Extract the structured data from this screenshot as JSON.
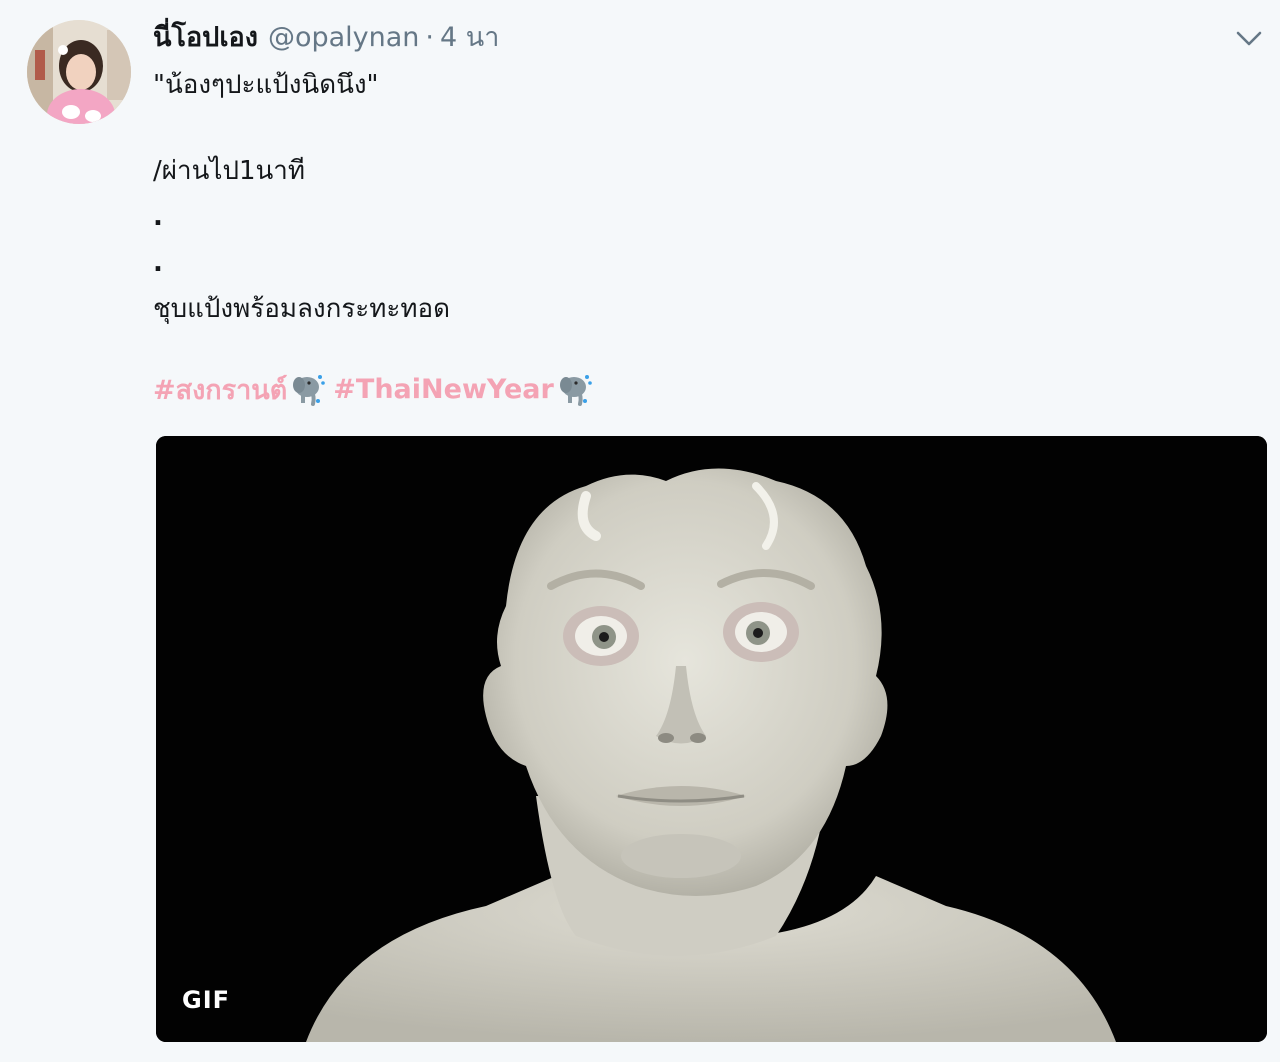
{
  "tweet": {
    "display_name": "นี่โอปเอง",
    "handle": "@opalynan",
    "separator": "·",
    "time": "4 นา",
    "text_lines": [
      "\"น้องๆปะแป้งนิดนึง\"",
      "",
      "/ผ่านไป1นาที",
      ".",
      ".",
      "ชุบแป้งพร้อมลงกระทะทอด"
    ],
    "hashtags": [
      {
        "text": "#สงกรานต์",
        "emoji": "elephant-splash-icon"
      },
      {
        "text": "#ThaiNewYear",
        "emoji": "elephant-splash-icon"
      }
    ],
    "hashtag_color": "#f4a3b4",
    "media": {
      "badge": "GIF",
      "subject": "face-covered-in-white-powder"
    },
    "menu_icon": "chevron-down-icon"
  }
}
